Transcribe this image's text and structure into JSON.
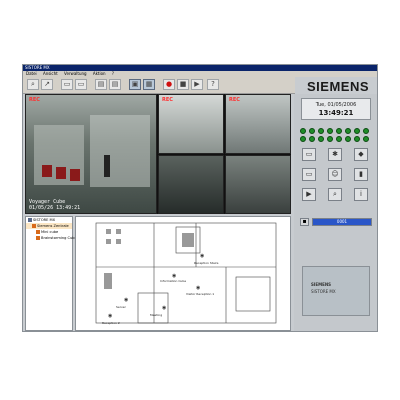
{
  "window": {
    "title": "SISTORE MX",
    "menu": [
      "Datei",
      "Ansicht",
      "Verwaltung",
      "Aktion",
      "?"
    ]
  },
  "toolbar": {
    "icons": [
      "zoom-icon",
      "arrow-icon",
      "cam-icon",
      "cam-icon",
      "grid-icon",
      "grid-icon",
      "fullscreen-icon",
      "split-view-icon",
      "record-icon",
      "stop-icon",
      "play-icon",
      "help-icon"
    ]
  },
  "brand": "SIEMENS",
  "status": {
    "date": "Tue, 01/05/2006",
    "time": "13:49:21",
    "leds": 16
  },
  "cameras": [
    {
      "rec": "REC",
      "caption_1": "Voyager Cube",
      "caption_2": "01/05/26 13:49:21"
    },
    {
      "rec": "REC",
      "caption_1": "",
      "caption_2": ""
    },
    {
      "rec": "REC",
      "caption_1": "",
      "caption_2": ""
    },
    {
      "rec": "",
      "caption_1": "",
      "caption_2": ""
    },
    {
      "rec": "",
      "caption_1": "",
      "caption_2": ""
    }
  ],
  "tree": {
    "root": "SISTORE MX",
    "items": [
      "Siemens Zentrale",
      "Mini cube",
      "Brainstorming Cube"
    ]
  },
  "map_labels": [
    "Reception Stairs",
    "Information Cube",
    "Visitor Reception 1",
    "Server",
    "Meeting",
    "Reception 2"
  ],
  "progress": {
    "label": "0001",
    "value": 1.0
  },
  "logo": {
    "line1": "SIEMENS",
    "line2": "SISTORE MX"
  },
  "colors": {
    "title_bar": "#0a246a",
    "led": "#1e8c28",
    "progress": "#2a56c8",
    "rec": "#ff3030"
  }
}
